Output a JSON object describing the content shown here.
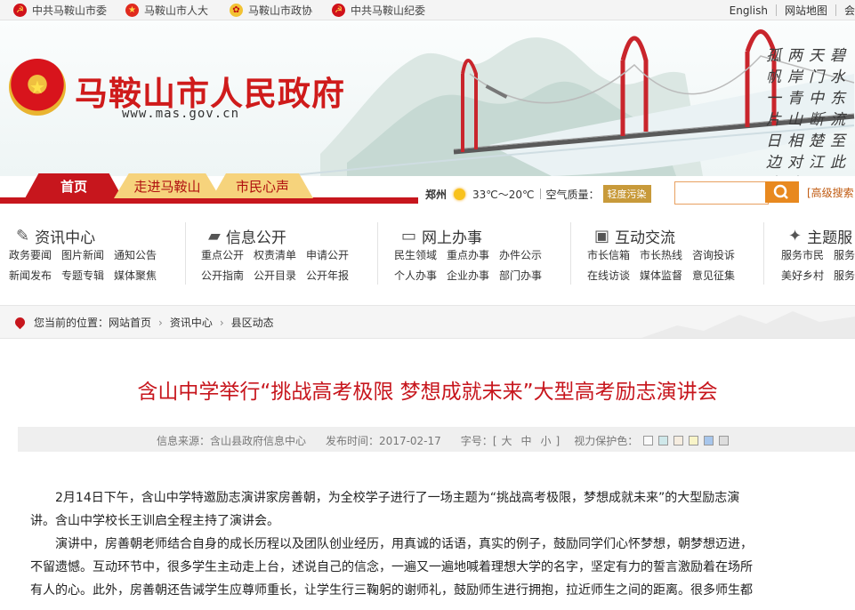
{
  "top_links": [
    {
      "label": "中共马鞍山市委",
      "icon": "party-emblem-icon"
    },
    {
      "label": "马鞍山市人大",
      "icon": "national-emblem-icon"
    },
    {
      "label": "马鞍山市政协",
      "icon": "cppcc-emblem-icon"
    },
    {
      "label": "中共马鞍山纪委",
      "icon": "party-emblem-icon"
    }
  ],
  "top_right": {
    "english": "English",
    "sitemap": "网站地图",
    "more": "会"
  },
  "header": {
    "title": "马鞍山市人民政府",
    "url": "www.mas.gov.cn",
    "poem_columns": [
      "孤帆一片日边来",
      "两岸青山相对出",
      "天门中断楚江开",
      "碧水东流至此回"
    ]
  },
  "nav_tabs": [
    "首页",
    "走进马鞍山",
    "市民心声"
  ],
  "weather": {
    "city": "郑州",
    "temp": "33℃～20℃",
    "aqi_label": "空气质量：",
    "aqi_value": "轻度污染"
  },
  "search": {
    "placeholder": "",
    "advanced": "[高级搜索"
  },
  "categories": [
    {
      "title": "资讯中心",
      "icon": "pen-icon",
      "row1": [
        "政务要闻",
        "图片新闻",
        "通知公告"
      ],
      "row2": [
        "新闻发布",
        "专题专辑",
        "媒体聚焦"
      ]
    },
    {
      "title": "信息公开",
      "icon": "briefcase-icon",
      "row1": [
        "重点公开",
        "权责清单",
        "申请公开"
      ],
      "row2": [
        "公开指南",
        "公开目录",
        "公开年报"
      ]
    },
    {
      "title": "网上办事",
      "icon": "monitor-icon",
      "row1": [
        "民生领域",
        "重点办事",
        "办件公示"
      ],
      "row2": [
        "个人办事",
        "企业办事",
        "部门办事"
      ]
    },
    {
      "title": "互动交流",
      "icon": "chat-icon",
      "row1": [
        "市长信箱",
        "市长热线",
        "咨询投诉"
      ],
      "row2": [
        "在线访谈",
        "媒体监督",
        "意见征集"
      ]
    },
    {
      "title": "主题服",
      "icon": "star-icon",
      "row1": [
        "服务市民",
        "服务"
      ],
      "row2": [
        "美好乡村",
        "服务"
      ]
    }
  ],
  "breadcrumb": {
    "prefix": "您当前的位置：",
    "items": [
      "网站首页",
      "资讯中心",
      "县区动态"
    ]
  },
  "article": {
    "title": "含山中学举行“挑战高考极限 梦想成就未来”大型高考励志演讲会",
    "meta": {
      "source_label": "信息来源：",
      "source": "含山县政府信息中心",
      "time_label": "发布时间：",
      "time": "2017-02-17",
      "font_label": "字号：",
      "font_open": "[",
      "font_large": "大",
      "font_mid": "中",
      "font_small": "小",
      "font_close": "]",
      "vision_label": "视力保护色："
    },
    "swatch_colors": [
      "#fafafa",
      "#cfe8ea",
      "#f6ede0",
      "#f8f4c8",
      "#a7c6ec",
      "#dddddd"
    ],
    "paragraphs": [
      "2月14日下午，含山中学特邀励志演讲家房善朝，为全校学子进行了一场主题为“挑战高考极限，梦想成就未来”的大型励志演",
      "讲。含山中学校长王训启全程主持了演讲会。",
      "演讲中，房善朝老师结合自身的成长历程以及团队创业经历，用真诚的话语，真实的例子，鼓励同学们心怀梦想，朝梦想迈进，",
      "不留遗憾。互动环节中，很多学生主动走上台，述说自己的信念，一遍又一遍地喊着理想大学的名字，坚定有力的誓言激励着在场所",
      "有人的心。此外，房善朝还告诫学生应尊师重长，让学生行三鞠躬的谢师礼，鼓励师生进行拥抱，拉近师生之间的距离。很多师生都"
    ]
  },
  "colors": {
    "brand_red": "#c7161d",
    "tab_gold": "#f6d37c",
    "search_orange": "#e8891f"
  }
}
